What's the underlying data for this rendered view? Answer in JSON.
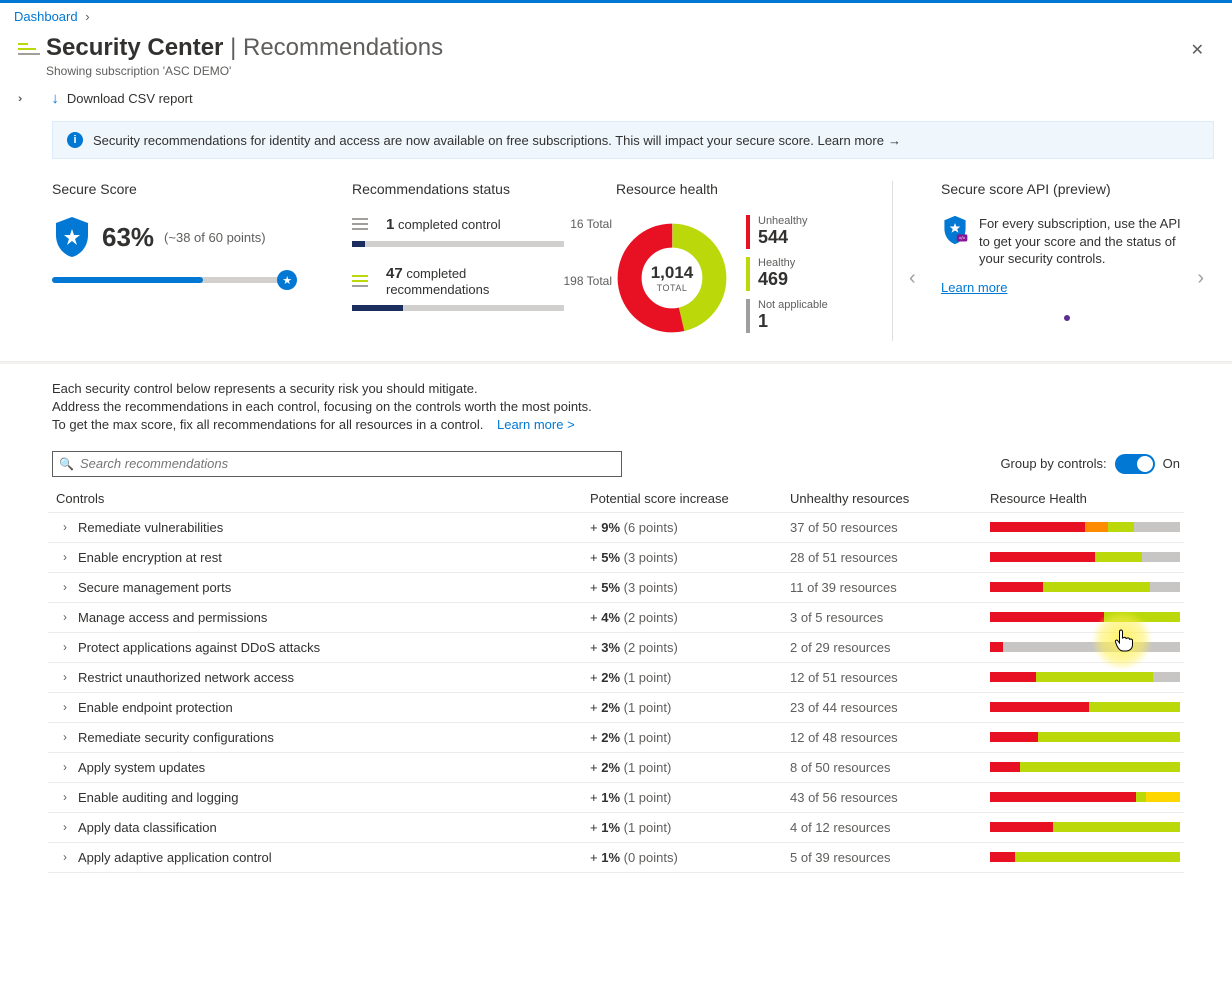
{
  "breadcrumb": {
    "dashboard": "Dashboard"
  },
  "header": {
    "title_main": "Security Center",
    "title_sep": " | ",
    "title_sub": "Recommendations",
    "subtitle": "Showing subscription 'ASC DEMO'"
  },
  "cmdbar": {
    "download": "Download CSV report"
  },
  "banner": {
    "text": "Security recommendations for identity and access are now available on free subscriptions. This will impact your secure score. Learn more"
  },
  "overview": {
    "score": {
      "title": "Secure Score",
      "pct": "63%",
      "points": "(~38 of 60 points)",
      "fill_pct": 63,
      "marker_pct": 98
    },
    "rec": {
      "title": "Recommendations status",
      "controls_n": "1",
      "controls_label": "completed control",
      "controls_total": "16 Total",
      "controls_fill_pct": 6,
      "recs_n": "47",
      "recs_label": "completed recommendations",
      "recs_total": "198 Total",
      "recs_fill_pct": 24
    },
    "health": {
      "title": "Resource health",
      "total": "1,014",
      "total_label": "TOTAL",
      "unhealthy_label": "Unhealthy",
      "unhealthy": "544",
      "healthy_label": "Healthy",
      "healthy": "469",
      "na_label": "Not applicable",
      "na": "1"
    },
    "api": {
      "title": "Secure score API (preview)",
      "text": "For every subscription, use the API to get your score and the status of your security controls.",
      "learn": "Learn more"
    }
  },
  "desc": {
    "l1": "Each security control below represents a security risk you should mitigate.",
    "l2": "Address the recommendations in each control, focusing on the controls worth the most points.",
    "l3": "To get the max score, fix all recommendations for all resources in a control.",
    "learn": "Learn more >"
  },
  "search": {
    "placeholder": "Search recommendations"
  },
  "group": {
    "label": "Group by controls:",
    "state": "On"
  },
  "columns": {
    "controls": "Controls",
    "psi": "Potential score increase",
    "unhealthy": "Unhealthy resources",
    "health": "Resource Health"
  },
  "rows": [
    {
      "name": "Remediate vulnerabilities",
      "pct": "9%",
      "pts": "(6 points)",
      "ur": "37 of 50 resources",
      "bars": [
        [
          "#e81123",
          50
        ],
        [
          "#ff8c00",
          12
        ],
        [
          "#bad80a",
          14
        ],
        [
          "#c8c6c4",
          24
        ]
      ]
    },
    {
      "name": "Enable encryption at rest",
      "pct": "5%",
      "pts": "(3 points)",
      "ur": "28 of 51 resources",
      "bars": [
        [
          "#e81123",
          55
        ],
        [
          "#bad80a",
          25
        ],
        [
          "#c8c6c4",
          20
        ]
      ]
    },
    {
      "name": "Secure management ports",
      "pct": "5%",
      "pts": "(3 points)",
      "ur": "11 of 39 resources",
      "bars": [
        [
          "#e81123",
          28
        ],
        [
          "#bad80a",
          56
        ],
        [
          "#c8c6c4",
          16
        ]
      ]
    },
    {
      "name": "Manage access and permissions",
      "pct": "4%",
      "pts": "(2 points)",
      "ur": "3 of 5 resources",
      "bars": [
        [
          "#e81123",
          60
        ],
        [
          "#bad80a",
          40
        ]
      ]
    },
    {
      "name": "Protect applications against DDoS attacks",
      "pct": "3%",
      "pts": "(2 points)",
      "ur": "2 of 29 resources",
      "bars": [
        [
          "#e81123",
          7
        ],
        [
          "#c8c6c4",
          93
        ]
      ]
    },
    {
      "name": "Restrict unauthorized network access",
      "pct": "2%",
      "pts": "(1 point)",
      "ur": "12 of 51 resources",
      "bars": [
        [
          "#e81123",
          24
        ],
        [
          "#bad80a",
          62
        ],
        [
          "#c8c6c4",
          14
        ]
      ]
    },
    {
      "name": "Enable endpoint protection",
      "pct": "2%",
      "pts": "(1 point)",
      "ur": "23 of 44 resources",
      "bars": [
        [
          "#e81123",
          52
        ],
        [
          "#bad80a",
          48
        ]
      ]
    },
    {
      "name": "Remediate security configurations",
      "pct": "2%",
      "pts": "(1 point)",
      "ur": "12 of 48 resources",
      "bars": [
        [
          "#e81123",
          25
        ],
        [
          "#bad80a",
          75
        ]
      ]
    },
    {
      "name": "Apply system updates",
      "pct": "2%",
      "pts": "(1 point)",
      "ur": "8 of 50 resources",
      "bars": [
        [
          "#e81123",
          16
        ],
        [
          "#bad80a",
          84
        ]
      ]
    },
    {
      "name": "Enable auditing and logging",
      "pct": "1%",
      "pts": "(1 point)",
      "ur": "43 of 56 resources",
      "bars": [
        [
          "#e81123",
          77
        ],
        [
          "#bad80a",
          5
        ],
        [
          "#ffd700",
          18
        ]
      ]
    },
    {
      "name": "Apply data classification",
      "pct": "1%",
      "pts": "(1 point)",
      "ur": "4 of 12 resources",
      "bars": [
        [
          "#e81123",
          33
        ],
        [
          "#bad80a",
          67
        ]
      ]
    },
    {
      "name": "Apply adaptive application control",
      "pct": "1%",
      "pts": "(0 points)",
      "ur": "5 of 39 resources",
      "bars": [
        [
          "#e81123",
          13
        ],
        [
          "#bad80a",
          87
        ]
      ]
    }
  ],
  "chart_data": {
    "type": "pie",
    "title": "Resource health",
    "series": [
      {
        "name": "Unhealthy",
        "value": 544,
        "color": "#e81123"
      },
      {
        "name": "Healthy",
        "value": 469,
        "color": "#bad80a"
      },
      {
        "name": "Not applicable",
        "value": 1,
        "color": "#a19f9d"
      }
    ],
    "total": 1014
  }
}
